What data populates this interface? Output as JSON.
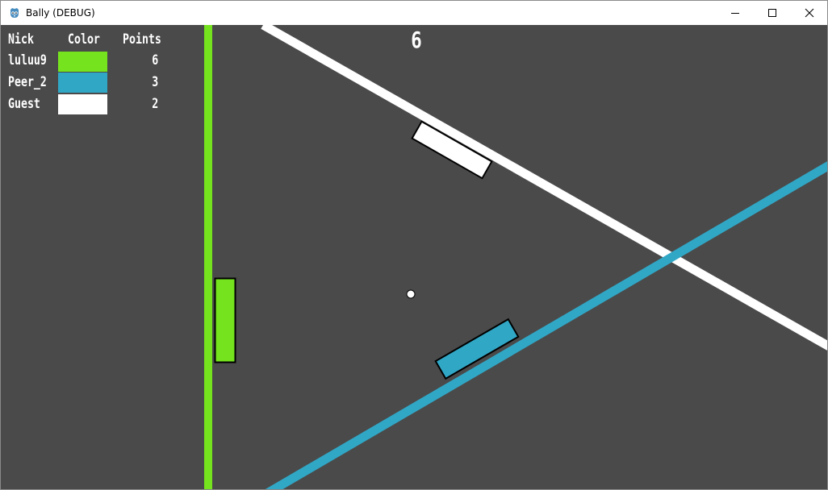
{
  "window": {
    "title": "Bally (DEBUG)",
    "app_icon": "godot-icon",
    "controls": [
      "minimize-icon",
      "maximize-icon",
      "close-icon"
    ]
  },
  "scoreboard": {
    "headers": {
      "nick": "Nick",
      "color": "Color",
      "points": "Points"
    },
    "players": [
      {
        "nick": "luluu9",
        "color": "#75e31e",
        "points": "6"
      },
      {
        "nick": "Peer_2",
        "color": "#31a7c6",
        "points": "3"
      },
      {
        "nick": "Guest",
        "color": "#ffffff",
        "points": "2"
      }
    ]
  },
  "hud": {
    "center_score": "6"
  },
  "colors": {
    "background": "#4a4a4a",
    "player_green": "#75e31e",
    "player_blue": "#31a7c6",
    "player_white": "#ffffff",
    "outline": "#000000"
  }
}
